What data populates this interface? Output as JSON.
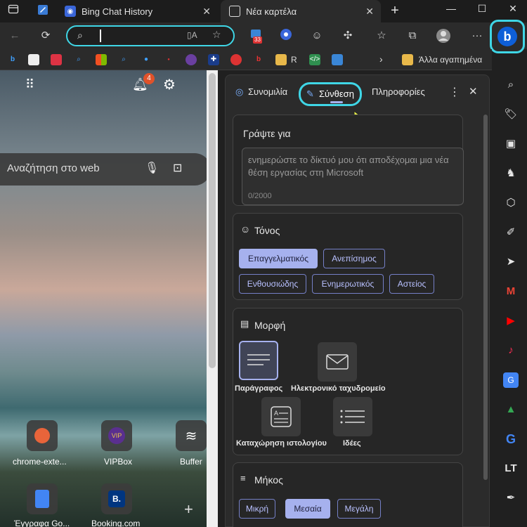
{
  "tabs": [
    {
      "title": "Bing Chat History"
    },
    {
      "title": "Νέα καρτέλα"
    }
  ],
  "bookmarks": {
    "folder_label": "R",
    "other_label": "Άλλα αγαπημένα"
  },
  "toolbar": {
    "extension_badge": "33"
  },
  "ntp": {
    "search_placeholder": "Αναζήτηση στο web",
    "notification_count": "4",
    "quick_links": [
      {
        "label": "chrome-exte..."
      },
      {
        "label": "VIPBox"
      },
      {
        "label": "Buffer"
      },
      {
        "label": "Έγγραφα Go..."
      },
      {
        "label": "Booking.com"
      }
    ]
  },
  "panel": {
    "tabs": {
      "chat": "Συνομιλία",
      "compose": "Σύνθεση",
      "insights": "Πληροφορίες"
    },
    "write_about_title": "Γράψτε για",
    "write_about_placeholder": "ενημερώστε το δίκτυό μου ότι αποδέχομαι μια νέα θέση εργασίας στη Microsoft",
    "char_count": "0/2000",
    "tone": {
      "title": "Τόνος",
      "options": [
        "Επαγγελματικός",
        "Ανεπίσημος",
        "Ενθουσιώδης",
        "Ενημερωτικός",
        "Αστείος"
      ],
      "selected": "Επαγγελματικός"
    },
    "format": {
      "title": "Μορφή",
      "options": [
        "Παράγραφος",
        "Ηλεκτρονικό ταχυδρομείο",
        "Καταχώρηση ιστολογίου",
        "Ιδέες"
      ],
      "selected": "Παράγραφος"
    },
    "length": {
      "title": "Μήκος",
      "options": [
        "Μικρή",
        "Μεσαία",
        "Μεγάλη"
      ],
      "selected": "Μεσαία"
    }
  },
  "colors": {
    "accent_highlight": "#3fd6e6",
    "chip_border": "#7580c7",
    "chip_selected": "#a6b1ee"
  }
}
